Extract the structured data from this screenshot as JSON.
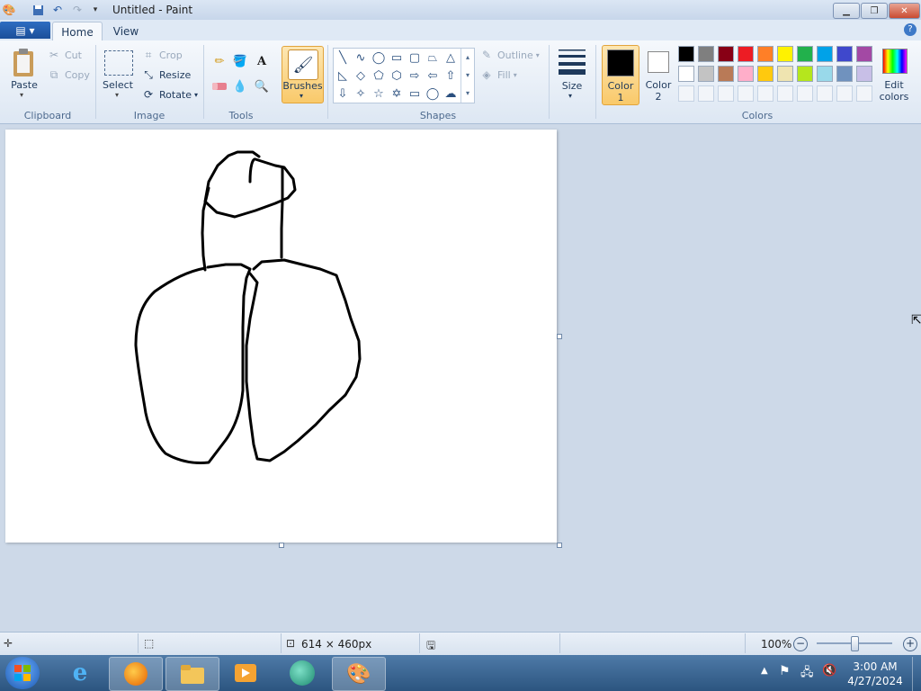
{
  "window": {
    "title": "Untitled - Paint"
  },
  "tabs": {
    "file_icon": "file-menu-icon",
    "home": "Home",
    "view": "View"
  },
  "clipboard": {
    "paste": "Paste",
    "cut": "Cut",
    "copy": "Copy",
    "label": "Clipboard"
  },
  "image": {
    "select": "Select",
    "crop": "Crop",
    "resize": "Resize",
    "rotate": "Rotate",
    "label": "Image"
  },
  "tools": {
    "label": "Tools"
  },
  "brushes": {
    "label": "Brushes"
  },
  "shapes": {
    "outline": "Outline",
    "fill": "Fill",
    "label": "Shapes"
  },
  "size": {
    "label": "Size"
  },
  "colors": {
    "color1_line1": "Color",
    "color1_line2": "1",
    "color2_line1": "Color",
    "color2_line2": "2",
    "edit_line1": "Edit",
    "edit_line2": "colors",
    "label": "Colors",
    "palette_row1": [
      "#000000",
      "#7f7f7f",
      "#880015",
      "#ed1c24",
      "#ff7f27",
      "#fff200",
      "#22b14c",
      "#00a2e8",
      "#3f48cc",
      "#a349a4"
    ],
    "palette_row2": [
      "#ffffff",
      "#c3c3c3",
      "#b97a57",
      "#ffaec9",
      "#ffc90e",
      "#efe4b0",
      "#b5e61d",
      "#99d9ea",
      "#7092be",
      "#c8bfe7"
    ]
  },
  "status": {
    "dimensions": "614 × 460px",
    "zoom": "100%"
  },
  "taskbar": {
    "time": "3:00 AM",
    "date": "4/27/2024"
  }
}
